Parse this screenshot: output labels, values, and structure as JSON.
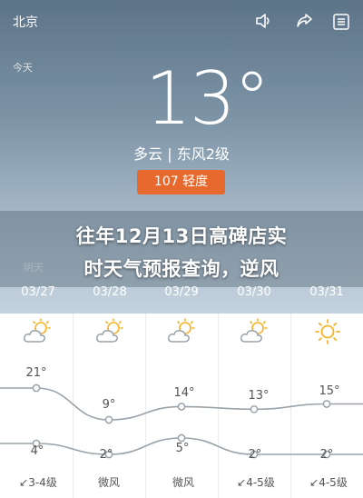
{
  "header": {
    "city": "北京",
    "today_label": "今天",
    "temperature": "13°",
    "condition": "多云 | 东风2级",
    "aqi": "107 轻度"
  },
  "overlay": {
    "line1": "往年12月13日高碑店实",
    "line2": "时天气预报查询，逆风"
  },
  "week_label": "明天",
  "days": [
    {
      "date": "03/27",
      "high": "21°",
      "low": "4°",
      "wind": "3-4级",
      "icon": "partly-cloudy-icon"
    },
    {
      "date": "03/28",
      "high": "9°",
      "low": "2°",
      "wind": "微风",
      "icon": "partly-cloudy-icon"
    },
    {
      "date": "03/29",
      "high": "14°",
      "low": "5°",
      "wind": "微风",
      "icon": "partly-cloudy-icon"
    },
    {
      "date": "03/30",
      "high": "13°",
      "low": "2°",
      "wind": "4-5级",
      "icon": "partly-cloudy-icon"
    },
    {
      "date": "03/31",
      "high": "15°",
      "low": "2°",
      "wind": "4-5级",
      "icon": "sun-icon"
    }
  ],
  "chart_data": {
    "type": "line",
    "categories": [
      "03/27",
      "03/28",
      "03/29",
      "03/30",
      "03/31"
    ],
    "series": [
      {
        "values": [
          21,
          9,
          14,
          13,
          15
        ]
      },
      {
        "values": [
          4,
          2,
          5,
          2,
          2
        ]
      }
    ]
  },
  "colors": {
    "aqi_badge": "#e8692e",
    "sky_top": "#5d7488",
    "sky_bottom": "#c4d2dd",
    "sun": "#f5b428",
    "curve": "#9aa3aa"
  }
}
